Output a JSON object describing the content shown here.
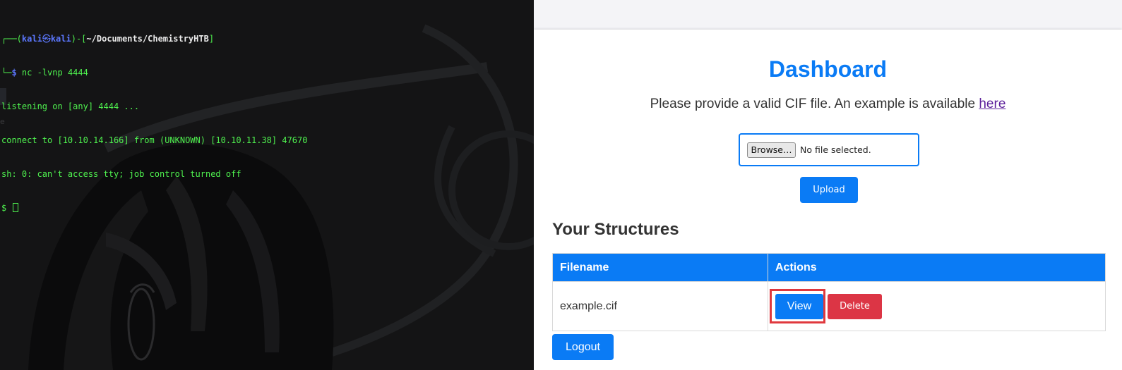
{
  "terminal": {
    "prompt_user": "kali",
    "prompt_sep": "㉿",
    "prompt_host": "kali",
    "prompt_path": "~/Documents/ChemistryHTB",
    "command": "nc -lvnp 4444",
    "output": [
      "listening on [any] 4444 ...",
      "connect to [10.10.14.166] from (UNKNOWN) [10.10.11.38] 47670",
      "sh: 0: can't access tty; job control turned off"
    ],
    "shell_prompt": "$",
    "stray_char": "e"
  },
  "page": {
    "title": "Dashboard",
    "subtitle_text": "Please provide a valid CIF file. An example is available ",
    "subtitle_link": "here",
    "browse_label": "Browse…",
    "no_file_label": "No file selected.",
    "upload_label": "Upload",
    "structures_heading": "Your Structures",
    "table": {
      "headers": [
        "Filename",
        "Actions"
      ],
      "rows": [
        {
          "filename": "example.cif",
          "view_label": "View",
          "delete_label": "Delete"
        }
      ]
    },
    "logout_label": "Logout"
  },
  "colors": {
    "primary": "#0a7bf5",
    "danger": "#dc3545",
    "highlight": "#e0393e",
    "terminal_green": "#4ff24f",
    "terminal_blue": "#5c78ff"
  }
}
